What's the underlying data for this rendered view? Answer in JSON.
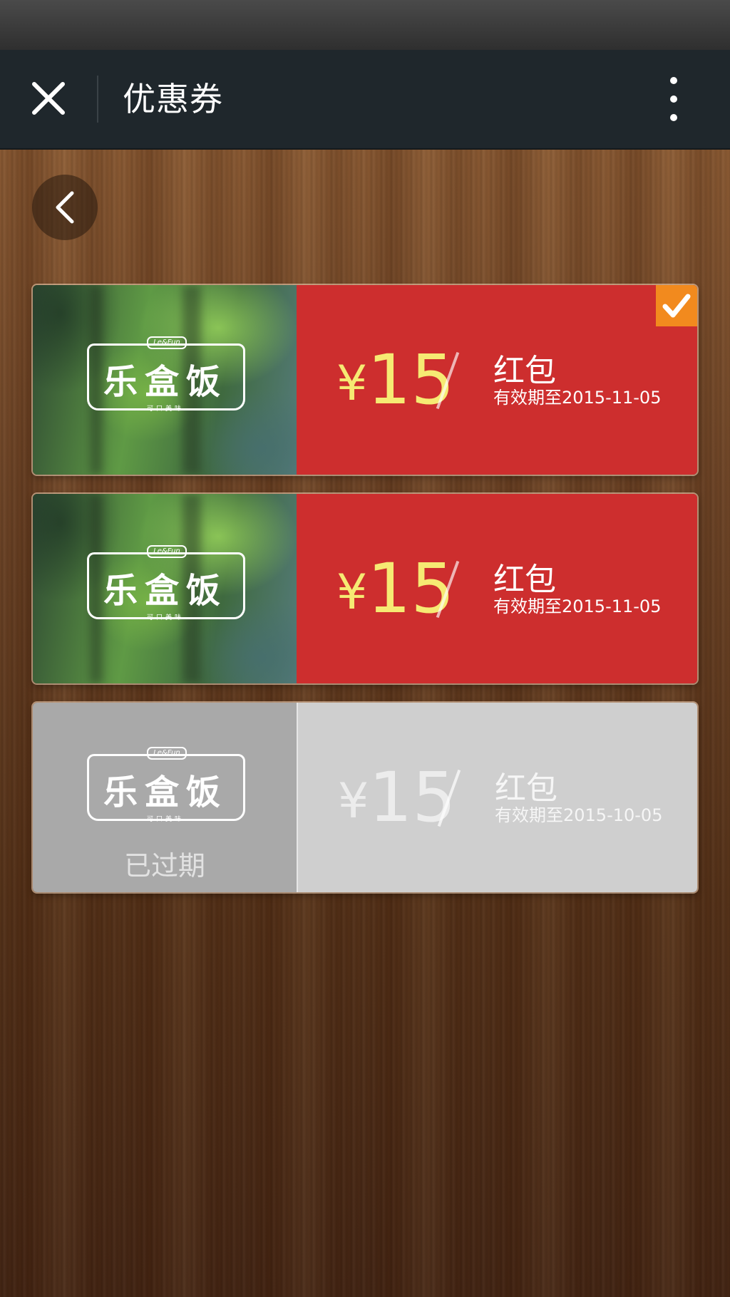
{
  "header": {
    "title": "优惠券",
    "close_icon": "close-icon",
    "more_icon": "more-vertical-icon"
  },
  "back_icon": "chevron-left-icon",
  "coupons": [
    {
      "brand": "乐盒饭",
      "currency": "¥",
      "amount": "15",
      "type": "红包",
      "validity": "有效期至2015-11-05",
      "selected": true,
      "expired": false
    },
    {
      "brand": "乐盒饭",
      "currency": "¥",
      "amount": "15",
      "type": "红包",
      "validity": "有效期至2015-11-05",
      "selected": false,
      "expired": false
    },
    {
      "brand": "乐盒饭",
      "currency": "¥",
      "amount": "15",
      "type": "红包",
      "validity": "有效期至2015-10-05",
      "selected": false,
      "expired": true,
      "expired_label": "已过期"
    }
  ],
  "colors": {
    "nav_bg": "#1f272c",
    "coupon_active": "#cd2e2e",
    "amount_yellow": "#f6ea73",
    "badge_orange": "#f28a1e",
    "coupon_expired": "#cfcfcf"
  }
}
